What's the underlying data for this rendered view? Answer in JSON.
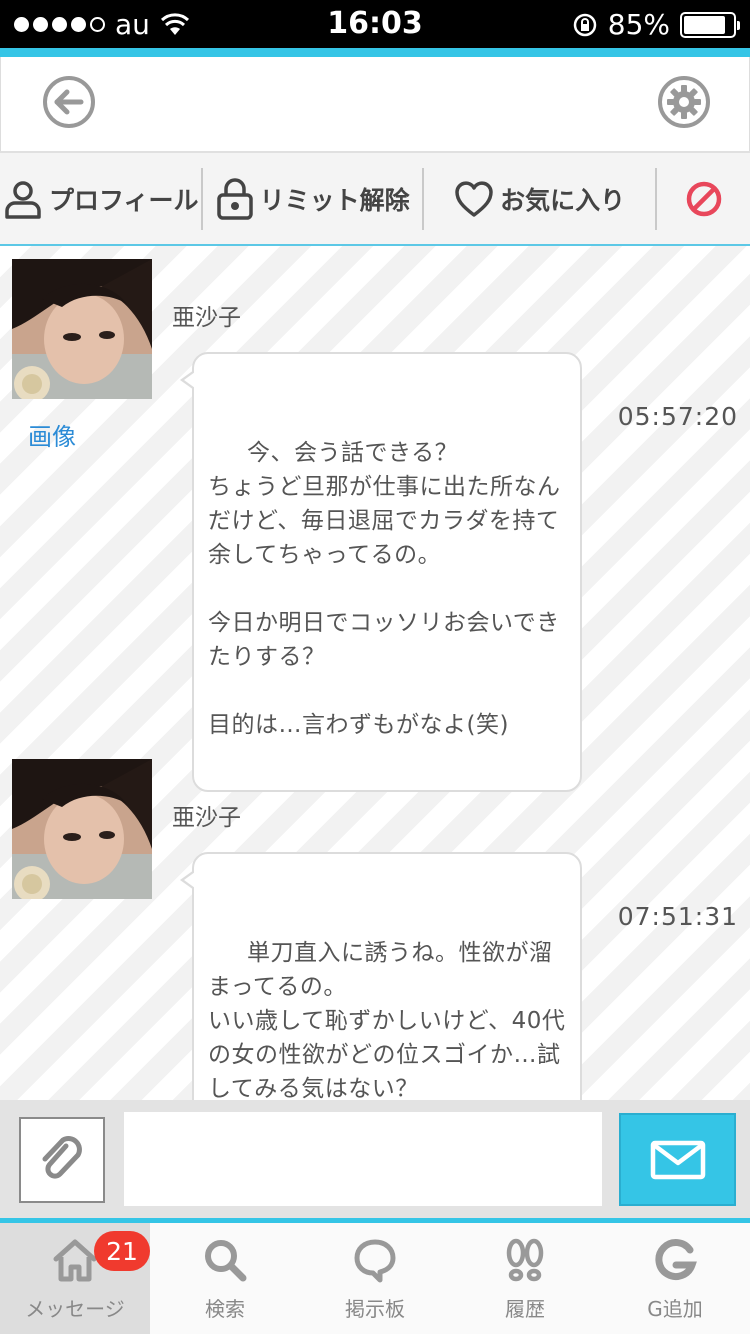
{
  "status_bar": {
    "carrier": "au",
    "time": "16:03",
    "battery": "85%",
    "battery_level": 0.85
  },
  "action_bar": {
    "profile": "プロフィール",
    "limit_release": "リミット解除",
    "favorite": "お気に入り"
  },
  "messages": [
    {
      "sender": "亜沙子",
      "photo_link": "画像",
      "text": " 今、会う話できる？\nちょうど旦那が仕事に出た所なんだけど、毎日退屈でカラダを持て余してちゃってるの。\n\n今日か明日でコッソリお会いできたりする？\n\n目的は…言わずもがなよ(笑)",
      "time": "05:57:20"
    },
    {
      "sender": "亜沙子",
      "text": " 単刀直入に誘うね。性欲が溜まってるの。\nいい歳して恥ずかしいけど、40代の女の性欲がどの位スゴイか…試してみる気はない？\n\nタイミングが合えば今日か明",
      "time": "07:51:31"
    }
  ],
  "input": {
    "value": ""
  },
  "tabs": [
    {
      "label": "メッセージ",
      "badge": "21"
    },
    {
      "label": "検索"
    },
    {
      "label": "掲示板"
    },
    {
      "label": "履歴"
    },
    {
      "label": "G追加"
    }
  ],
  "colors": {
    "accent": "#35c5e6",
    "badge": "#f03a2e",
    "block": "#e8475b",
    "link": "#2b8bd6"
  }
}
